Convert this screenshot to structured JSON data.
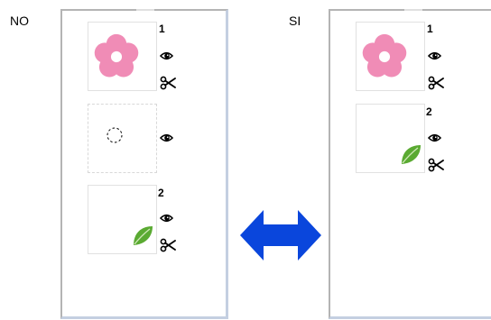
{
  "left_panel": {
    "label": "NO",
    "items": [
      {
        "number": "1",
        "kind": "flower"
      },
      {
        "number": "",
        "kind": "empty"
      },
      {
        "number": "2",
        "kind": "leaf"
      }
    ]
  },
  "right_panel": {
    "label": "SI",
    "items": [
      {
        "number": "1",
        "kind": "flower"
      },
      {
        "number": "2",
        "kind": "leaf"
      }
    ]
  },
  "colors": {
    "flower": "#f08cb6",
    "leaf": "#5aaa32",
    "arrow": "#0a46dc"
  },
  "icons": [
    "eye-icon",
    "scissors-icon",
    "dashed-circle-icon",
    "swap-arrow-icon"
  ]
}
